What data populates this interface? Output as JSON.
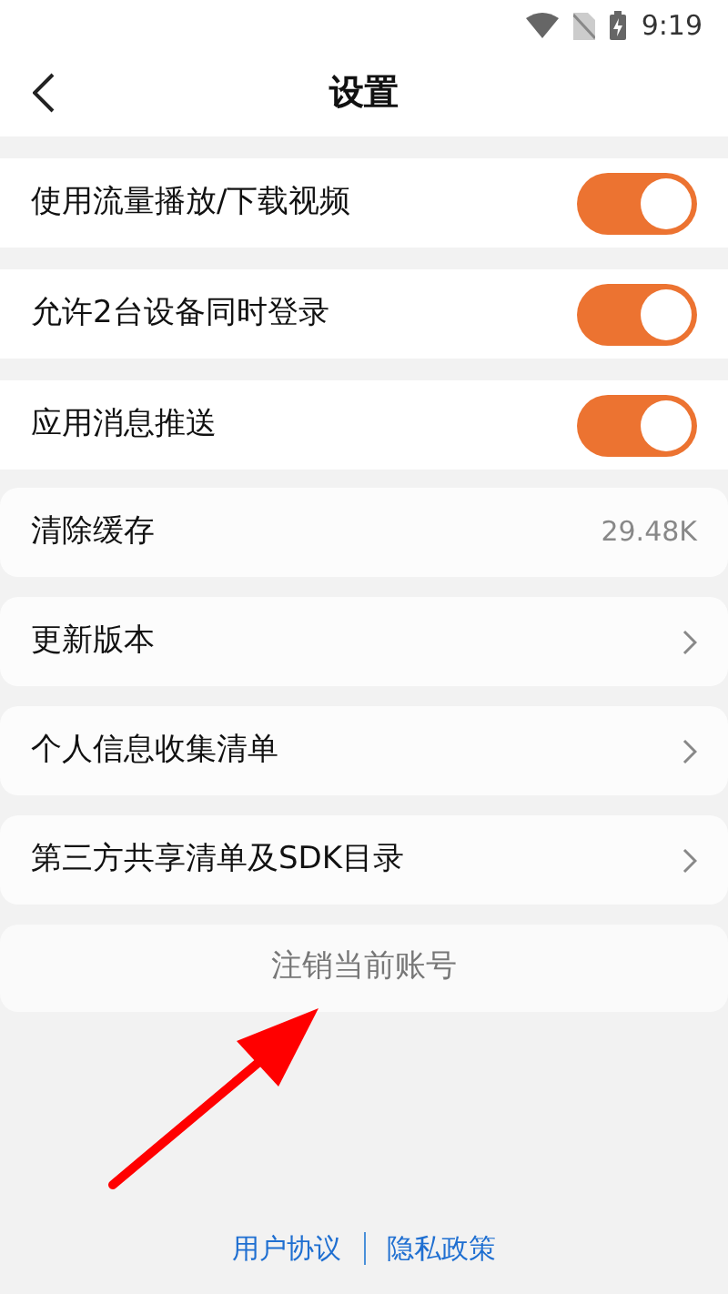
{
  "status_bar": {
    "time": "9:19"
  },
  "header": {
    "title": "设置"
  },
  "toggle_rows": [
    {
      "label": "使用流量播放/下载视频",
      "on": true
    },
    {
      "label": "允许2台设备同时登录",
      "on": true
    },
    {
      "label": "应用消息推送",
      "on": true
    }
  ],
  "menu_rows": [
    {
      "kind": "value",
      "label": "清除缓存",
      "value": "29.48K"
    },
    {
      "kind": "chevron",
      "label": "更新版本"
    },
    {
      "kind": "chevron",
      "label": "个人信息收集清单"
    },
    {
      "kind": "chevron",
      "label": "第三方共享清单及SDK目录"
    }
  ],
  "logout_button": {
    "label": "注销当前账号"
  },
  "footer_links": [
    "用户协议",
    "隐私政策"
  ]
}
